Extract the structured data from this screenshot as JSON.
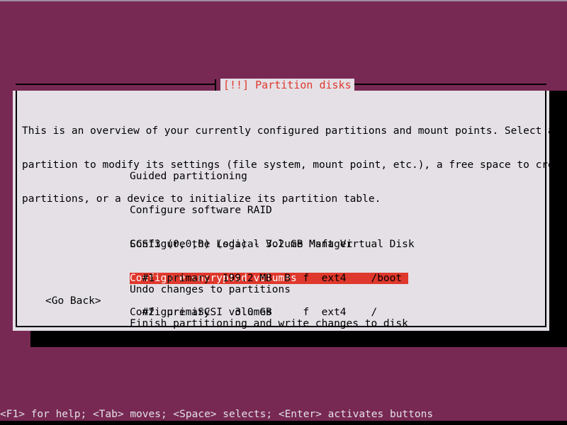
{
  "screen": {
    "background_color": "#772953",
    "text_color": "#000000",
    "panel_color": "#e4e0e6",
    "accent_color": "#df382c"
  },
  "dialog": {
    "title": "[!!] Partition disks",
    "intro_lines": [
      "This is an overview of your currently configured partitions and mount points. Select a",
      "partition to modify its settings (file system, mount point, etc.), a free space to create",
      "partitions, or a device to initialize its partition table."
    ]
  },
  "menu": {
    "items": [
      {
        "label": "Guided partitioning",
        "selected": false
      },
      {
        "label": "Configure software RAID",
        "selected": false
      },
      {
        "label": "Configure the Logical Volume Manager",
        "selected": false
      },
      {
        "label": "Configure encrypted volumes",
        "selected": true
      },
      {
        "label": "Configure iSCSI volumes",
        "selected": false
      }
    ]
  },
  "disks": {
    "device_line": "SCSI3 (0,0,0) (sda) - 3.2 GB Msft Virtual Disk",
    "partition_lines": [
      "  #1  primary  199.2 MB  B  f  ext4    /boot",
      "  #2  primary    3.0 GB     f  ext4    /"
    ]
  },
  "actions": {
    "items": [
      {
        "label": "Undo changes to partitions"
      },
      {
        "label": "Finish partitioning and write changes to disk"
      }
    ]
  },
  "buttons": {
    "go_back": "<Go Back>"
  },
  "help_bar": {
    "text": "<F1> for help; <Tab> moves; <Space> selects; <Enter> activates buttons"
  }
}
